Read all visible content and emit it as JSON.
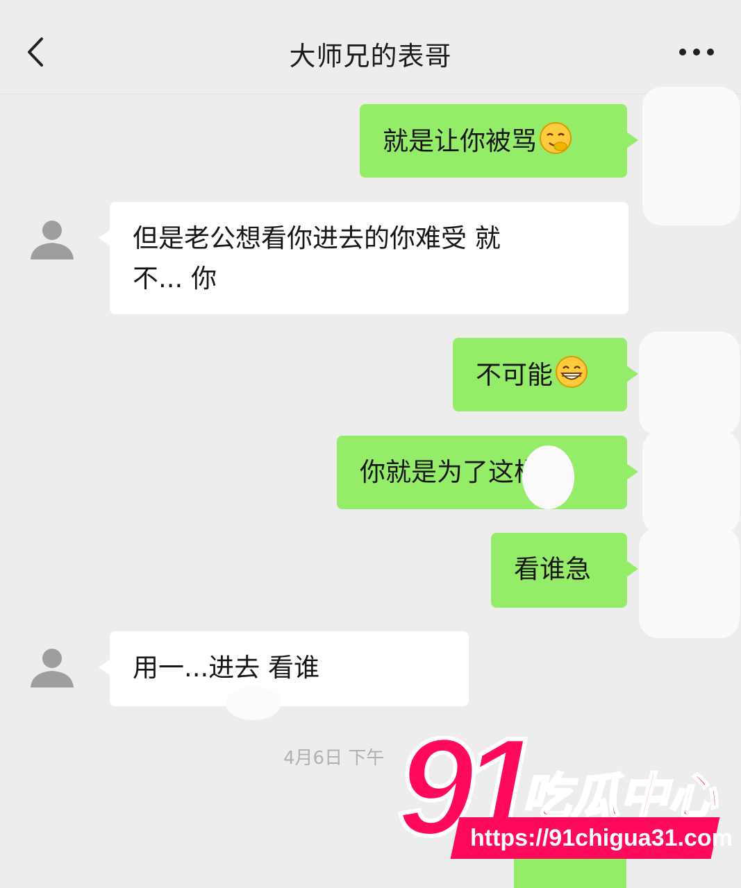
{
  "header": {
    "title": "大师兄的表哥",
    "back_icon": "chevron-left-icon",
    "more_icon": "more-dots-icon"
  },
  "messages": [
    {
      "side": "sent",
      "text": "就是让你被骂",
      "emoji": "smirk-face-emoji"
    },
    {
      "side": "recv",
      "text": "但是老公想看你进去的你难受 就\n不... 你"
    },
    {
      "side": "sent",
      "text": "不可能",
      "emoji": "grin-face-emoji"
    },
    {
      "side": "sent",
      "text": "你就是为了这样呢"
    },
    {
      "side": "sent",
      "text": "看谁急"
    },
    {
      "side": "recv",
      "text": "用一...进去 看谁"
    }
  ],
  "timestamp": "4月6日 下午",
  "watermark": {
    "number": "91",
    "name": "吃瓜中心",
    "url": "https://91chigua31.com"
  },
  "colors": {
    "sent_bubble": "#95ec69",
    "recv_bubble": "#ffffff",
    "background": "#ededed",
    "watermark": "#ff0a5b"
  }
}
